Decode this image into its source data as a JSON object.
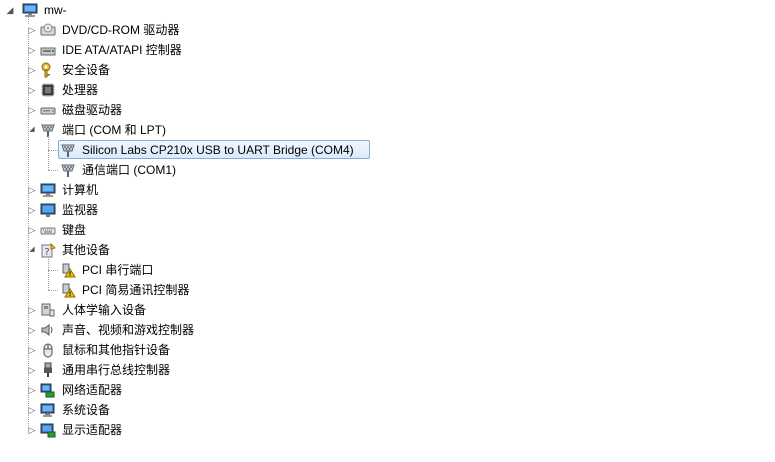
{
  "root": {
    "label": "mw-",
    "icon": "computer-icon"
  },
  "categories": [
    {
      "label": "DVD/CD-ROM 驱动器",
      "icon": "dvd-drive-icon",
      "expanded": false
    },
    {
      "label": "IDE ATA/ATAPI 控制器",
      "icon": "ide-controller-icon",
      "expanded": false
    },
    {
      "label": "安全设备",
      "icon": "security-key-icon",
      "expanded": false
    },
    {
      "label": "处理器",
      "icon": "processor-icon",
      "expanded": false
    },
    {
      "label": "磁盘驱动器",
      "icon": "disk-drive-icon",
      "expanded": false
    },
    {
      "label": "端口 (COM 和 LPT)",
      "icon": "port-icon",
      "expanded": true,
      "children": [
        {
          "label": "Silicon Labs CP210x USB to UART Bridge (COM4)",
          "icon": "port-icon",
          "selected": true
        },
        {
          "label": "通信端口 (COM1)",
          "icon": "port-icon"
        }
      ]
    },
    {
      "label": "计算机",
      "icon": "computer-icon",
      "expanded": false
    },
    {
      "label": "监视器",
      "icon": "monitor-icon",
      "expanded": false
    },
    {
      "label": "键盘",
      "icon": "keyboard-icon",
      "expanded": false
    },
    {
      "label": "其他设备",
      "icon": "unknown-device-icon",
      "expanded": true,
      "children": [
        {
          "label": "PCI 串行端口",
          "icon": "warning-device-icon"
        },
        {
          "label": "PCI 简易通讯控制器",
          "icon": "warning-device-icon"
        }
      ]
    },
    {
      "label": "人体学输入设备",
      "icon": "hid-icon",
      "expanded": false
    },
    {
      "label": "声音、视频和游戏控制器",
      "icon": "speaker-icon",
      "expanded": false
    },
    {
      "label": "鼠标和其他指针设备",
      "icon": "mouse-icon",
      "expanded": false
    },
    {
      "label": "通用串行总线控制器",
      "icon": "usb-plug-icon",
      "expanded": false
    },
    {
      "label": "网络适配器",
      "icon": "network-adapter-icon",
      "expanded": false
    },
    {
      "label": "系统设备",
      "icon": "system-device-icon",
      "expanded": false
    },
    {
      "label": "显示适配器",
      "icon": "display-adapter-icon",
      "expanded": false
    }
  ],
  "glyphs": {
    "collapsed": "▷",
    "expanded": "◢"
  },
  "colors": {
    "selection_border": "#84acdd",
    "selection_fill": "#dbe9fb",
    "warning": "#f5c400"
  }
}
